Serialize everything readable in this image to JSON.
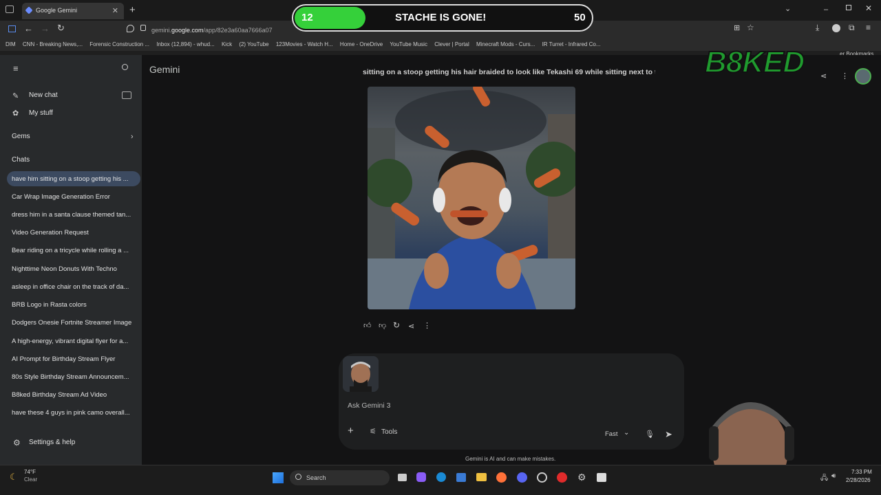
{
  "browser": {
    "tab_title": "Google Gemini",
    "url_prefix": "gemini.",
    "url_domain": "google.com",
    "url_path": "/app/82e3a60aa7666a07",
    "bookmarks": [
      "DIM",
      "CNN - Breaking News,...",
      "Forensic Construction ...",
      "Inbox (12,894) - whud...",
      "Kick",
      "(2) YouTube",
      "123Movies - Watch H...",
      "Home - OneDrive",
      "YouTube Music",
      "Clever | Portal",
      "Minecraft Mods - Curs...",
      "IR Turret - Infrared Co..."
    ],
    "other_bookmarks": "er Bookmarks"
  },
  "overlay": {
    "progress_current": "12",
    "progress_fraction": 0.24,
    "progress_text": "STACHE IS GONE!",
    "progress_goal": "50",
    "logo_text": "B8KED"
  },
  "sidebar": {
    "new_chat": "New chat",
    "my_stuff": "My stuff",
    "gems": "Gems",
    "chats_heading": "Chats",
    "chats": [
      "have him sitting on a stoop getting his ...",
      "Car Wrap Image Generation Error",
      "dress him in a santa clause themed tan...",
      "Video Generation Request",
      "Bear riding on a tricycle while rolling a ...",
      "Nighttime Neon Donuts With Techno",
      "asleep in office chair on the track of da...",
      "BRB Logo in Rasta colors",
      "Dodgers Onesie Fortnite Streamer Image",
      "A high-energy, vibrant digital flyer for a...",
      "AI Prompt for Birthday Stream Flyer",
      "80s Style Birthday Stream Announcem...",
      "B8ked Birthday Stream Ad Video",
      "have these 4 guys in pink camo overall..."
    ],
    "settings": "Settings & help"
  },
  "main": {
    "app_title": "Gemini",
    "prompt_text": "sitting on a stoop getting his hair braided to look like Tekashi 69 while sitting next to t",
    "input_placeholder": "Ask Gemini 3",
    "tools_label": "Tools",
    "mode_label": "Fast",
    "disclaimer": "Gemini is AI and can make mistakes."
  },
  "taskbar": {
    "weather_temp": "74°F",
    "weather_desc": "Clear",
    "search_label": "Search",
    "time": "7:33 PM",
    "date": "2/28/2026"
  },
  "colors": {
    "accent_green": "#35d03a",
    "active_chat_bg": "#3c4a60",
    "main_bg": "#131314"
  }
}
